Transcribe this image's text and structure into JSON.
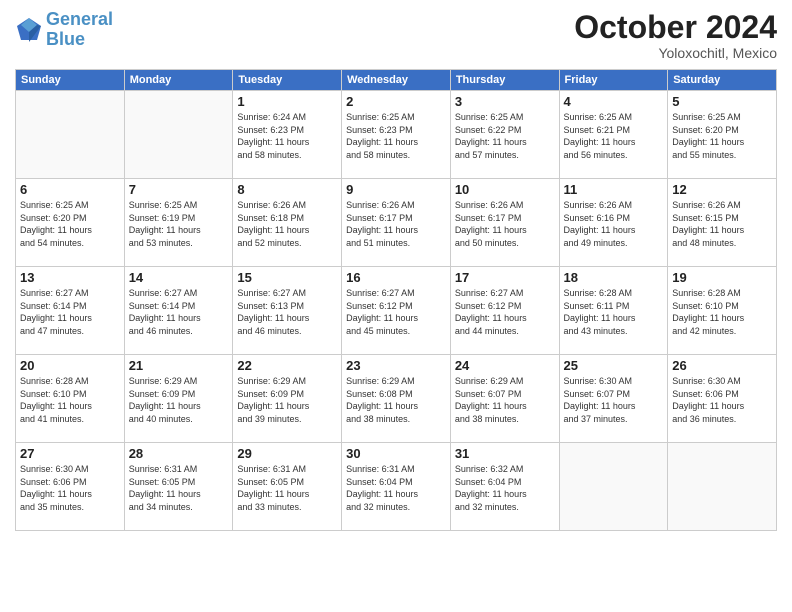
{
  "header": {
    "logo_line1": "General",
    "logo_line2": "Blue",
    "month_title": "October 2024",
    "location": "Yoloxochitl, Mexico"
  },
  "weekdays": [
    "Sunday",
    "Monday",
    "Tuesday",
    "Wednesday",
    "Thursday",
    "Friday",
    "Saturday"
  ],
  "weeks": [
    [
      {
        "day": "",
        "info": ""
      },
      {
        "day": "",
        "info": ""
      },
      {
        "day": "1",
        "info": "Sunrise: 6:24 AM\nSunset: 6:23 PM\nDaylight: 11 hours\nand 58 minutes."
      },
      {
        "day": "2",
        "info": "Sunrise: 6:25 AM\nSunset: 6:23 PM\nDaylight: 11 hours\nand 58 minutes."
      },
      {
        "day": "3",
        "info": "Sunrise: 6:25 AM\nSunset: 6:22 PM\nDaylight: 11 hours\nand 57 minutes."
      },
      {
        "day": "4",
        "info": "Sunrise: 6:25 AM\nSunset: 6:21 PM\nDaylight: 11 hours\nand 56 minutes."
      },
      {
        "day": "5",
        "info": "Sunrise: 6:25 AM\nSunset: 6:20 PM\nDaylight: 11 hours\nand 55 minutes."
      }
    ],
    [
      {
        "day": "6",
        "info": "Sunrise: 6:25 AM\nSunset: 6:20 PM\nDaylight: 11 hours\nand 54 minutes."
      },
      {
        "day": "7",
        "info": "Sunrise: 6:25 AM\nSunset: 6:19 PM\nDaylight: 11 hours\nand 53 minutes."
      },
      {
        "day": "8",
        "info": "Sunrise: 6:26 AM\nSunset: 6:18 PM\nDaylight: 11 hours\nand 52 minutes."
      },
      {
        "day": "9",
        "info": "Sunrise: 6:26 AM\nSunset: 6:17 PM\nDaylight: 11 hours\nand 51 minutes."
      },
      {
        "day": "10",
        "info": "Sunrise: 6:26 AM\nSunset: 6:17 PM\nDaylight: 11 hours\nand 50 minutes."
      },
      {
        "day": "11",
        "info": "Sunrise: 6:26 AM\nSunset: 6:16 PM\nDaylight: 11 hours\nand 49 minutes."
      },
      {
        "day": "12",
        "info": "Sunrise: 6:26 AM\nSunset: 6:15 PM\nDaylight: 11 hours\nand 48 minutes."
      }
    ],
    [
      {
        "day": "13",
        "info": "Sunrise: 6:27 AM\nSunset: 6:14 PM\nDaylight: 11 hours\nand 47 minutes."
      },
      {
        "day": "14",
        "info": "Sunrise: 6:27 AM\nSunset: 6:14 PM\nDaylight: 11 hours\nand 46 minutes."
      },
      {
        "day": "15",
        "info": "Sunrise: 6:27 AM\nSunset: 6:13 PM\nDaylight: 11 hours\nand 46 minutes."
      },
      {
        "day": "16",
        "info": "Sunrise: 6:27 AM\nSunset: 6:12 PM\nDaylight: 11 hours\nand 45 minutes."
      },
      {
        "day": "17",
        "info": "Sunrise: 6:27 AM\nSunset: 6:12 PM\nDaylight: 11 hours\nand 44 minutes."
      },
      {
        "day": "18",
        "info": "Sunrise: 6:28 AM\nSunset: 6:11 PM\nDaylight: 11 hours\nand 43 minutes."
      },
      {
        "day": "19",
        "info": "Sunrise: 6:28 AM\nSunset: 6:10 PM\nDaylight: 11 hours\nand 42 minutes."
      }
    ],
    [
      {
        "day": "20",
        "info": "Sunrise: 6:28 AM\nSunset: 6:10 PM\nDaylight: 11 hours\nand 41 minutes."
      },
      {
        "day": "21",
        "info": "Sunrise: 6:29 AM\nSunset: 6:09 PM\nDaylight: 11 hours\nand 40 minutes."
      },
      {
        "day": "22",
        "info": "Sunrise: 6:29 AM\nSunset: 6:09 PM\nDaylight: 11 hours\nand 39 minutes."
      },
      {
        "day": "23",
        "info": "Sunrise: 6:29 AM\nSunset: 6:08 PM\nDaylight: 11 hours\nand 38 minutes."
      },
      {
        "day": "24",
        "info": "Sunrise: 6:29 AM\nSunset: 6:07 PM\nDaylight: 11 hours\nand 38 minutes."
      },
      {
        "day": "25",
        "info": "Sunrise: 6:30 AM\nSunset: 6:07 PM\nDaylight: 11 hours\nand 37 minutes."
      },
      {
        "day": "26",
        "info": "Sunrise: 6:30 AM\nSunset: 6:06 PM\nDaylight: 11 hours\nand 36 minutes."
      }
    ],
    [
      {
        "day": "27",
        "info": "Sunrise: 6:30 AM\nSunset: 6:06 PM\nDaylight: 11 hours\nand 35 minutes."
      },
      {
        "day": "28",
        "info": "Sunrise: 6:31 AM\nSunset: 6:05 PM\nDaylight: 11 hours\nand 34 minutes."
      },
      {
        "day": "29",
        "info": "Sunrise: 6:31 AM\nSunset: 6:05 PM\nDaylight: 11 hours\nand 33 minutes."
      },
      {
        "day": "30",
        "info": "Sunrise: 6:31 AM\nSunset: 6:04 PM\nDaylight: 11 hours\nand 32 minutes."
      },
      {
        "day": "31",
        "info": "Sunrise: 6:32 AM\nSunset: 6:04 PM\nDaylight: 11 hours\nand 32 minutes."
      },
      {
        "day": "",
        "info": ""
      },
      {
        "day": "",
        "info": ""
      }
    ]
  ]
}
